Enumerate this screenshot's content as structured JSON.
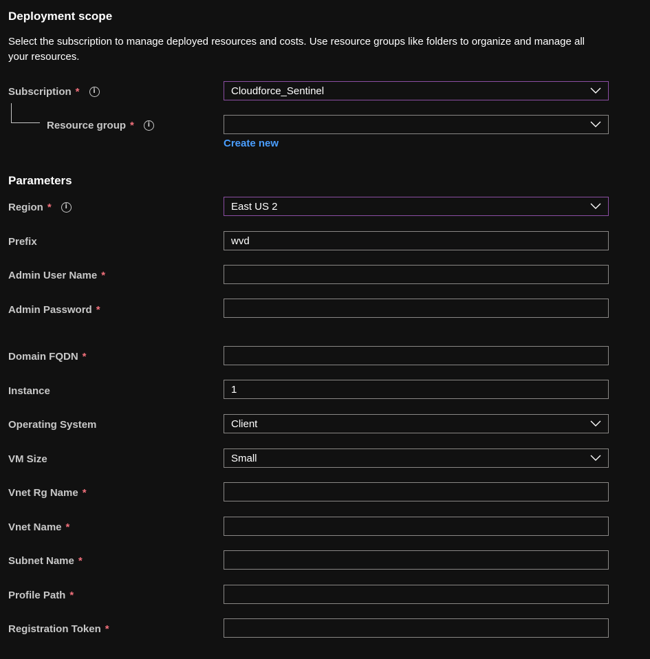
{
  "deployment_scope": {
    "title": "Deployment scope",
    "description": "Select the subscription to manage deployed resources and costs. Use resource groups like folders to organize and manage all your resources.",
    "subscription": {
      "label": "Subscription",
      "required_mark": "*",
      "value": "Cloudforce_Sentinel"
    },
    "resource_group": {
      "label": "Resource group",
      "required_mark": "*",
      "value": "",
      "create_new": "Create new"
    }
  },
  "parameters": {
    "title": "Parameters",
    "region": {
      "label": "Region",
      "required_mark": "*",
      "value": "East US 2"
    },
    "prefix": {
      "label": "Prefix",
      "value": "wvd"
    },
    "admin_user_name": {
      "label": "Admin User Name",
      "required_mark": "*",
      "value": ""
    },
    "admin_password": {
      "label": "Admin Password",
      "required_mark": "*",
      "value": ""
    },
    "domain_fqdn": {
      "label": "Domain FQDN",
      "required_mark": "*",
      "value": ""
    },
    "instance": {
      "label": "Instance",
      "value": "1"
    },
    "operating_system": {
      "label": "Operating System",
      "value": "Client"
    },
    "vm_size": {
      "label": "VM Size",
      "value": "Small"
    },
    "vnet_rg_name": {
      "label": "Vnet Rg Name",
      "required_mark": "*",
      "value": ""
    },
    "vnet_name": {
      "label": "Vnet Name",
      "required_mark": "*",
      "value": ""
    },
    "subnet_name": {
      "label": "Subnet Name",
      "required_mark": "*",
      "value": ""
    },
    "profile_path": {
      "label": "Profile Path",
      "required_mark": "*",
      "value": ""
    },
    "registration_token": {
      "label": "Registration Token",
      "required_mark": "*",
      "value": ""
    }
  },
  "colors": {
    "background": "#111111",
    "required": "#f1707b",
    "link": "#4a9eff",
    "focus_border": "#8c4fa4",
    "field_border": "#8a8886"
  },
  "icons": {
    "info": "info-icon",
    "dropdown": "chevron-down-icon"
  }
}
